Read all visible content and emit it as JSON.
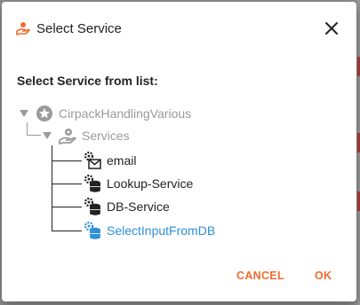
{
  "dialog": {
    "title": "Select Service",
    "title_icon": "hand-service-icon",
    "close_icon": "close-icon",
    "subtitle": "Select Service from list:"
  },
  "tree": {
    "root": {
      "label": "CirpackHandlingVarious",
      "icon": "star-badge-icon",
      "expanded": true
    },
    "group": {
      "label": "Services",
      "icon": "service-hand-icon",
      "expanded": true
    },
    "items": [
      {
        "label": "email",
        "icon": "gear-envelope-icon",
        "selected": false
      },
      {
        "label": "Lookup-Service",
        "icon": "gear-database-icon",
        "selected": false
      },
      {
        "label": "DB-Service",
        "icon": "gear-database-icon",
        "selected": false
      },
      {
        "label": "SelectInputFromDB",
        "icon": "gear-database-icon",
        "selected": true
      }
    ]
  },
  "actions": {
    "cancel_label": "CANCEL",
    "ok_label": "OK"
  },
  "colors": {
    "accent": "#f26b2f",
    "selected": "#2e8fd6",
    "muted": "#9a9a9a",
    "text": "#222222"
  }
}
